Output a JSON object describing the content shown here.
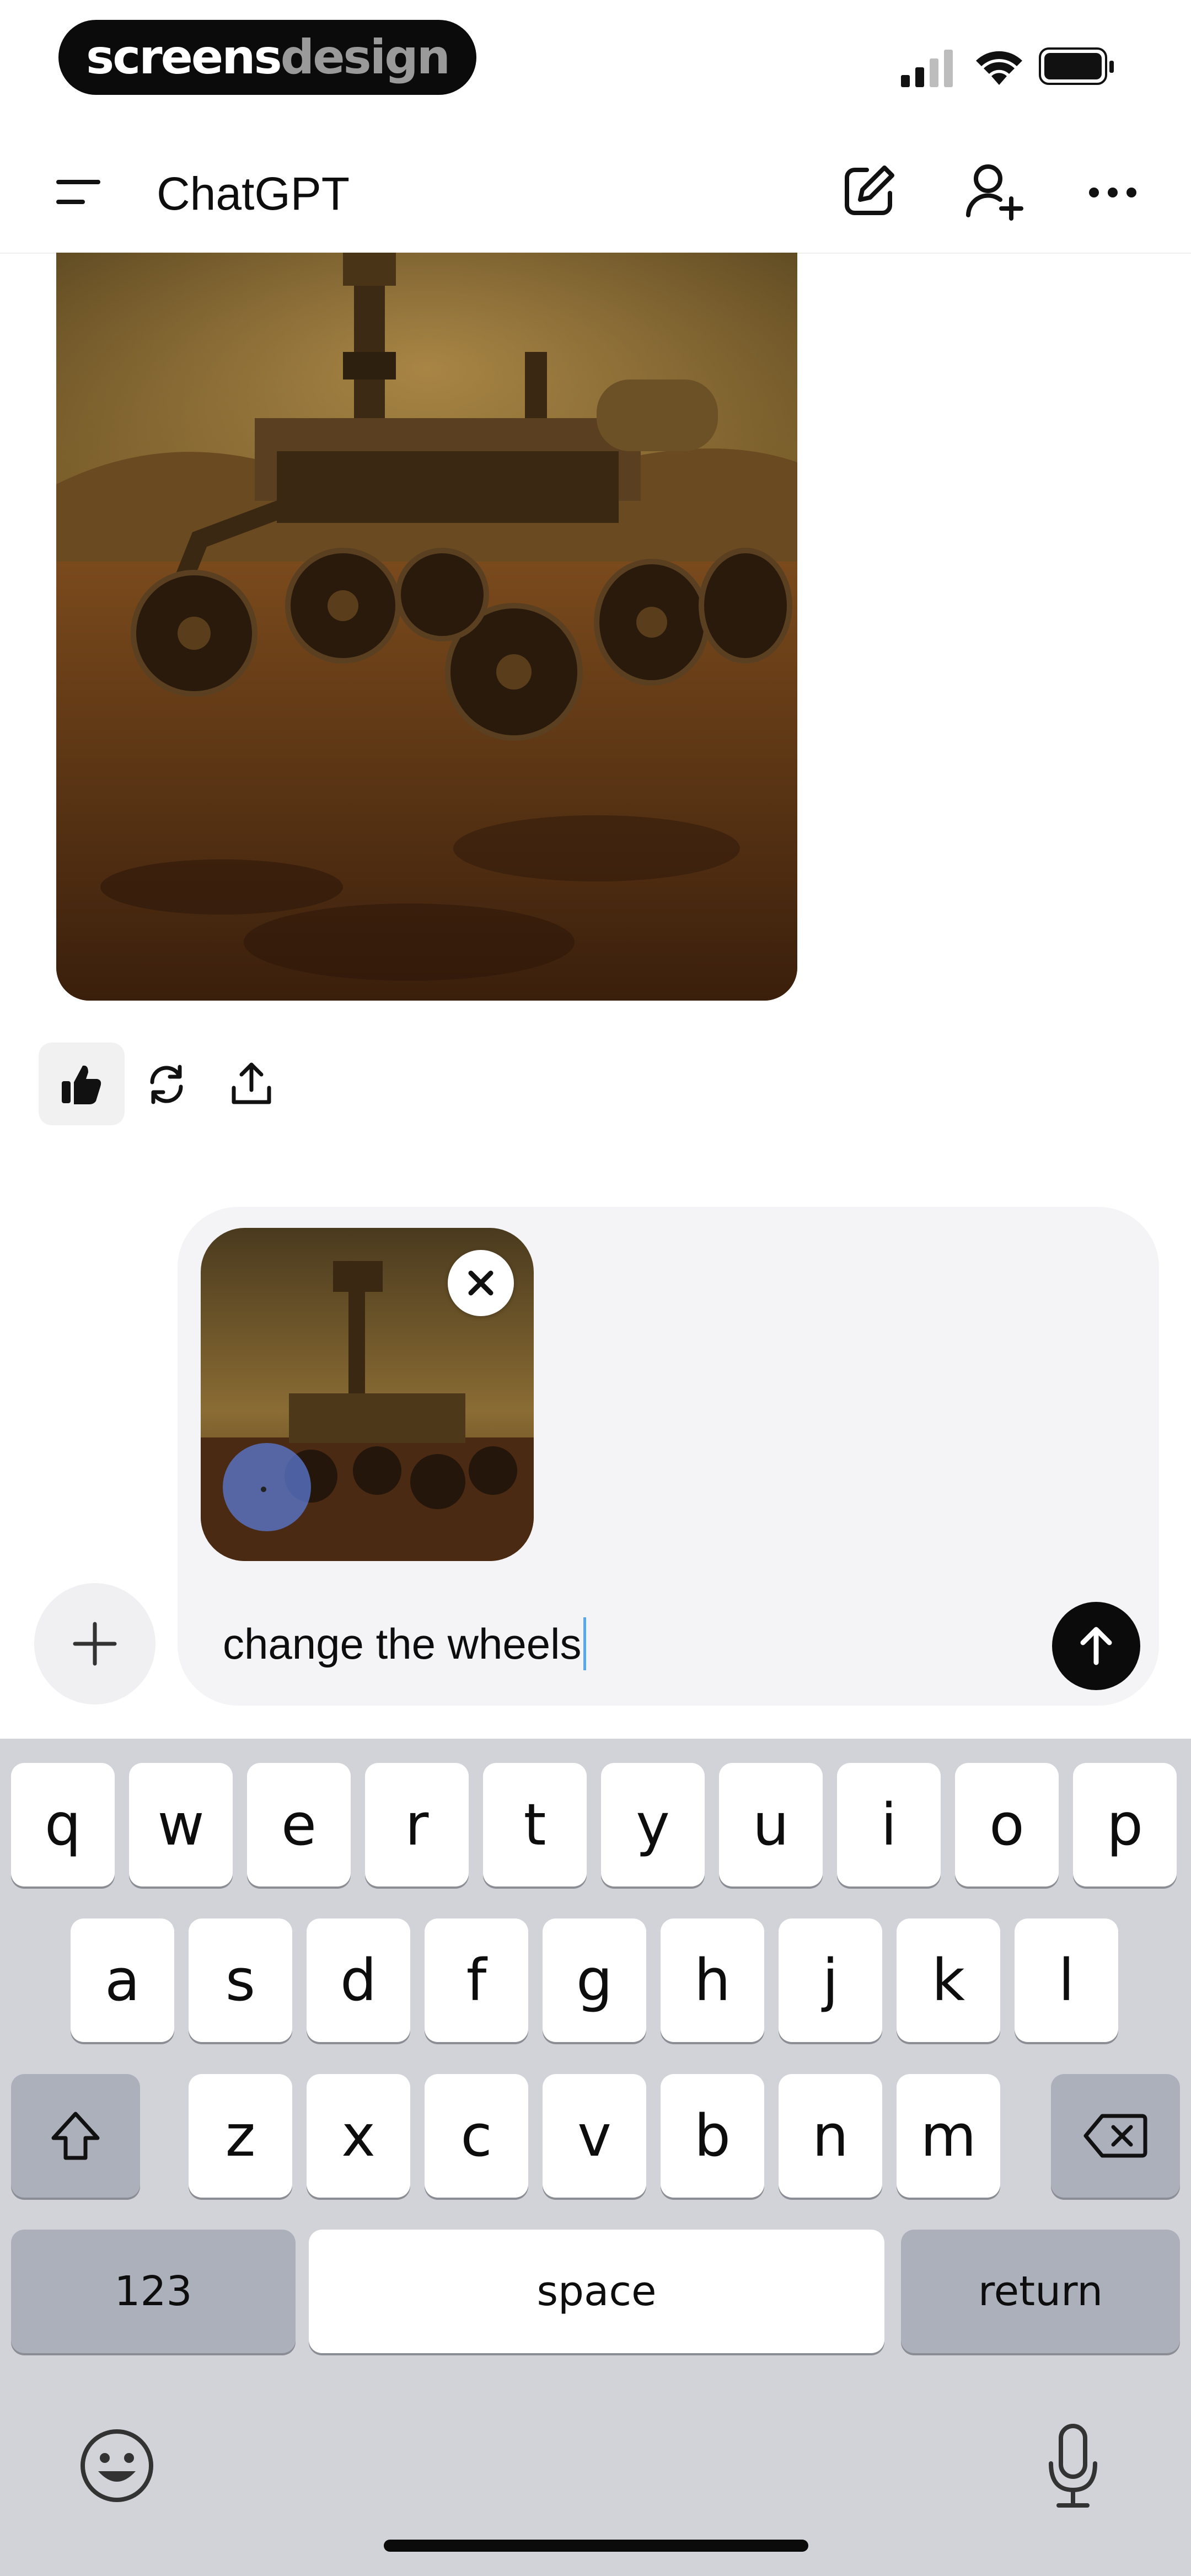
{
  "status_bar": {
    "brand_part1": "screens",
    "brand_part2": "design",
    "icons": [
      "cellular-signal-icon",
      "wifi-icon",
      "battery-icon"
    ]
  },
  "header": {
    "title": "ChatGPT",
    "icons": [
      "menu-icon",
      "new-chat-icon",
      "add-person-icon",
      "more-icon"
    ]
  },
  "message": {
    "image": "generated-rover-painting",
    "actions": [
      "thumbs-up-icon",
      "regenerate-icon",
      "share-icon"
    ],
    "liked": true
  },
  "composer": {
    "attachment": "rover-image-with-selection",
    "text": "change the wheels",
    "icons": [
      "remove-attachment-icon",
      "send-arrow-icon",
      "plus-icon"
    ]
  },
  "keyboard": {
    "row1": [
      "q",
      "w",
      "e",
      "r",
      "t",
      "y",
      "u",
      "i",
      "o",
      "p"
    ],
    "row2": [
      "a",
      "s",
      "d",
      "f",
      "g",
      "h",
      "j",
      "k",
      "l"
    ],
    "row3": [
      "z",
      "x",
      "c",
      "v",
      "b",
      "n",
      "m"
    ],
    "numbers_label": "123",
    "space_label": "space",
    "return_label": "return",
    "icons": [
      "shift-icon",
      "delete-icon",
      "emoji-icon",
      "microphone-icon"
    ]
  },
  "colors": {
    "accent": "#0b0b0b",
    "composer_bg": "#f4f3f5",
    "keyboard_bg": "#d1d3d9",
    "caret": "#58a8e8"
  }
}
